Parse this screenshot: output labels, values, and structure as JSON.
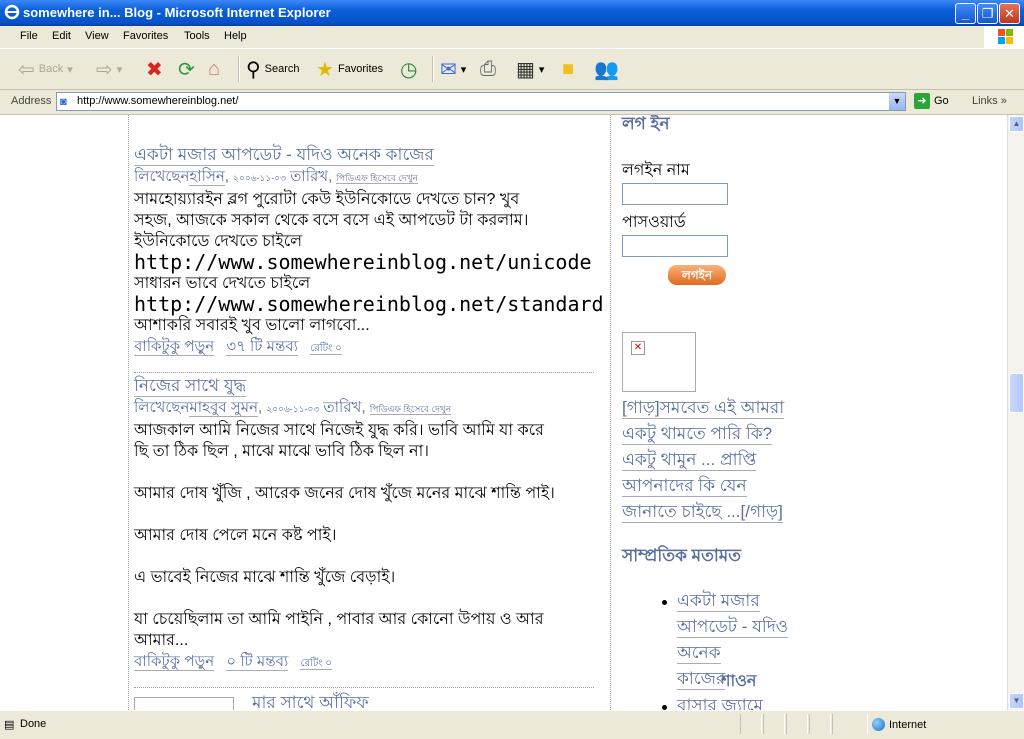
{
  "window": {
    "title": "somewhere in... Blog - Microsoft Internet Explorer"
  },
  "menu": [
    "File",
    "Edit",
    "View",
    "Favorites",
    "Tools",
    "Help"
  ],
  "toolbar": {
    "back": "Back",
    "search": "Search",
    "favorites": "Favorites"
  },
  "address": {
    "label": "Address",
    "url": "http://www.somewhereinblog.net/",
    "go": "Go",
    "links": "Links"
  },
  "posts": [
    {
      "title": "একটা মজার আপডেট - যদিও অনেক কাজের",
      "meta_by": "লিখেছেন",
      "author": "হাসিন",
      "date": "২০০৬-১১-০৩",
      "date_suffix": "তারিখ",
      "pdf": "পিডিএফ হিসেবে দেখুন",
      "lines": [
        "সামহোয়্যারইন ব্লগ পুরোটা কেউ ইউনিকোডে দেখতে চান? খুব",
        "সহজ, আজকে সকাল থেকে বসে বসে এই আপডেট টা করলাম।",
        "ইউনিকোডে দেখতে চাইলে",
        "http://www.somewhereinblog.net/unicode",
        "সাধারন ভাবে দেখতে চাইলে",
        "http://www.somewhereinblog.net/standard",
        "আশাকরি সবারই খুব ভালো লাগবো..."
      ],
      "read_more": "বাকিটুকু পড়ুন",
      "comments": "৩৭ টি মন্তব্য",
      "rating": "রেটিং ০"
    },
    {
      "title": "নিজের সাথে যুদ্ধ",
      "meta_by": "লিখেছেন",
      "author": "মাহবুব সুমন",
      "date": "২০০৬-১১-০৩",
      "date_suffix": "তারিখ",
      "pdf": "পিডিএফ হিসেবে দেখুন",
      "lines": [
        "আজকাল আমি নিজের সাথে নিজেই যুদ্ধ করি। ভাবি আমি যা করে",
        "ছি তা ঠিক ছিল , মাঝে মাঝে ভাবি ঠিক ছিল না।",
        "",
        "আমার দোষ খুঁজি , আরেক জনের দোষ খুঁজে মনের মাঝে শান্তি পাই।",
        "",
        "আমার দোষ পেলে মনে কষ্ট পাই।",
        "",
        "এ ভাবেই নিজের মাঝে শান্তি খুঁজে বেড়াই।",
        "",
        "যা চেয়েছিলাম তা আমি পাইনি , পাবার আর কোনো উপায় ও আর",
        "আমার..."
      ],
      "read_more": "বাকিটুকু পড়ুন",
      "comments": "০ টি মন্তব্য",
      "rating": "রেটিং ০"
    }
  ],
  "third_post_title": "মার সাথে আঁফিফ",
  "sidebar": {
    "login_heading": "লগ ইন",
    "username_label": "লগইন নাম",
    "password_label": "পাসওয়ার্ড",
    "login_button": "লগইন",
    "links": [
      "[গাড়]সমবেত এই আমরা",
      "একটু থামতে পারি কি?",
      "একটু থামুন ... প্রাপ্তি",
      "আপনাদের কি যেন",
      "জানাতে চাইছে ...[/গাড়]"
    ],
    "recent_heading": "সাম্প্রতিক মতামত",
    "recent": [
      {
        "lines": [
          "একটা মজার",
          "আপডেট - যদিও",
          "অনেক",
          "কাজের"
        ],
        "author": "শাওন"
      },
      {
        "lines": [
          "বাসার জ্যামে"
        ]
      }
    ]
  },
  "status": {
    "left": "Done",
    "zone": "Internet"
  }
}
